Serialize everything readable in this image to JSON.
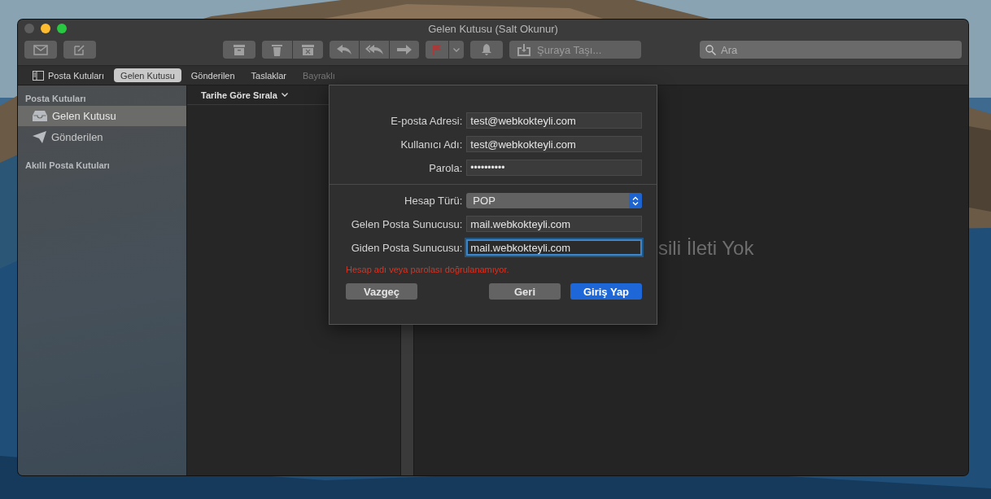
{
  "window": {
    "title": "Gelen Kutusu (Salt Okunur)"
  },
  "toolbar": {
    "move_to": "Şuraya Taşı...",
    "search": {
      "placeholder": "Ara"
    }
  },
  "favorites": [
    {
      "label": "Posta Kutuları",
      "kind": "toggle",
      "selected": false,
      "disabled": false
    },
    {
      "label": "Gelen Kutusu",
      "kind": "mailbox",
      "selected": true,
      "disabled": false
    },
    {
      "label": "Gönderilen",
      "kind": "mailbox",
      "selected": false,
      "disabled": false
    },
    {
      "label": "Taslaklar",
      "kind": "mailbox",
      "selected": false,
      "disabled": false
    },
    {
      "label": "Bayraklı",
      "kind": "mailbox",
      "selected": false,
      "disabled": true
    }
  ],
  "sidebar": {
    "sections": [
      {
        "title": "Posta Kutuları",
        "items": [
          {
            "label": "Gelen Kutusu",
            "kind": "inbox",
            "selected": true
          },
          {
            "label": "Gönderilen",
            "kind": "sent",
            "selected": false
          }
        ]
      },
      {
        "title": "Akıllı Posta Kutuları"
      }
    ]
  },
  "message_list": {
    "sort": "Tarihe Göre Sırala"
  },
  "viewer": {
    "empty_text": "sili İleti Yok"
  },
  "sheet": {
    "account_fields": [
      {
        "label": "E-posta Adresi:",
        "kind": "text",
        "value": "test@webkokteyli.com",
        "focused": false
      },
      {
        "label": "Kullanıcı Adı:",
        "kind": "text",
        "value": "test@webkokteyli.com",
        "focused": false
      },
      {
        "label": "Parola:",
        "kind": "password",
        "value": "••••••••••",
        "focused": false
      }
    ],
    "server_fields": [
      {
        "label": "Hesap Türü:",
        "kind": "popup",
        "value": "POP",
        "focused": false
      },
      {
        "label": "Gelen Posta Sunucusu:",
        "kind": "text",
        "value": "mail.webkokteyli.com",
        "focused": false
      },
      {
        "label": "Giden Posta Sunucusu:",
        "kind": "text",
        "value": "mail.webkokteyli.com",
        "focused": true
      }
    ],
    "error": "Hesap adı veya parolası doğrulanamıyor.",
    "buttons": [
      {
        "label": "Vazgeç",
        "kind": "cancel"
      },
      {
        "label": "Geri",
        "kind": "back"
      },
      {
        "label": "Giriş Yap",
        "kind": "default"
      }
    ]
  }
}
